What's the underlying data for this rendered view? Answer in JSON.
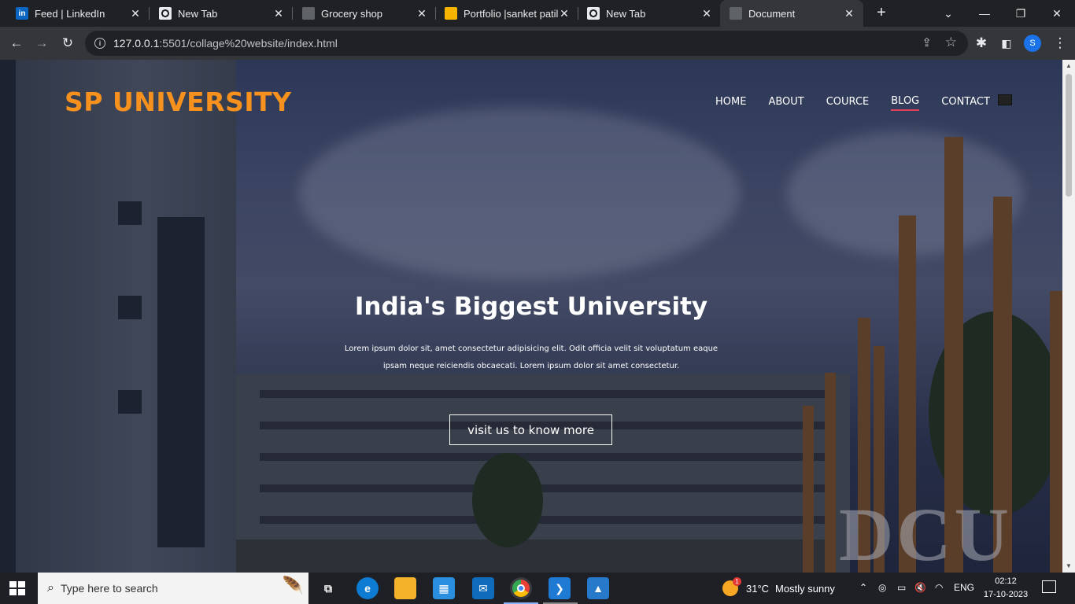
{
  "browser": {
    "tabs": [
      {
        "title": "Feed | LinkedIn",
        "favicon": "linkedin-icon",
        "fav_text": "in"
      },
      {
        "title": "New Tab",
        "favicon": "chrome-icon",
        "fav_text": ""
      },
      {
        "title": "Grocery shop",
        "favicon": "globe-icon",
        "fav_text": ""
      },
      {
        "title": "Portfolio |sanket patil",
        "favicon": "portfolio-icon",
        "fav_text": ""
      },
      {
        "title": "New Tab",
        "favicon": "chrome-icon",
        "fav_text": ""
      },
      {
        "title": "Document",
        "favicon": "globe-icon",
        "fav_text": "",
        "active": true
      }
    ],
    "url_host": "127.0.0.1",
    "url_path": ":5501/collage%20website/index.html",
    "profile_initial": "S"
  },
  "site": {
    "logo": "SP UNIVERSITY",
    "nav": [
      "HOME",
      "ABOUT",
      "COURCE",
      "BLOG",
      "CONTACT"
    ],
    "active_nav": "BLOG",
    "hero": {
      "title": "India's Biggest University",
      "text": "Lorem ipsum dolor sit, amet consectetur adipisicing elit. Odit officia velit sit voluptatum eaque ipsam neque reiciendis obcaecati. Lorem ipsum dolor sit amet consectetur.",
      "button": "visit us to know more"
    },
    "colors": {
      "logo": "#f7911e",
      "active_underline": "#e0405a"
    }
  },
  "taskbar": {
    "search_placeholder": "Type here to search",
    "weather_temp": "31°C",
    "weather_desc": "Mostly sunny",
    "weather_badge": "1",
    "language": "ENG",
    "time": "02:12",
    "date": "17-10-2023"
  }
}
